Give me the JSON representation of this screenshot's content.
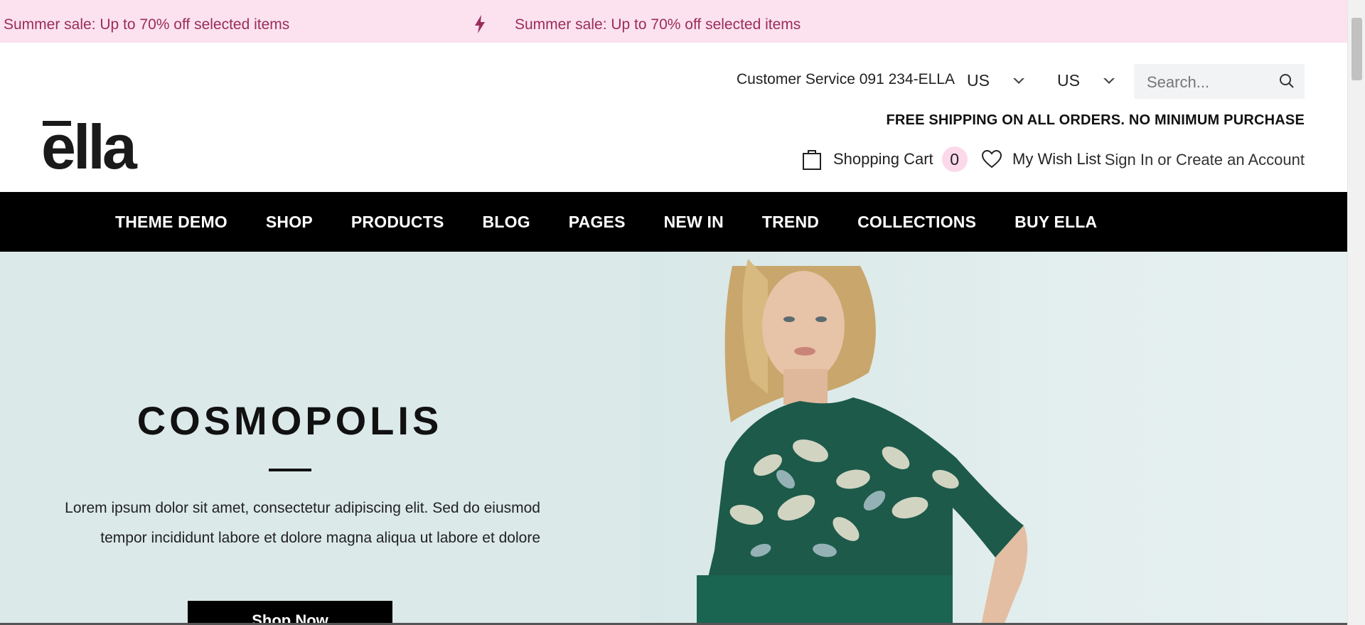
{
  "announcement": {
    "messages": [
      "Summer sale: Up to 70% off selected items",
      "Summer sale: Up to 70% off selected items"
    ],
    "icon": "lightning-bolt-icon",
    "color": "#9b2c5c",
    "background": "#fbe2ee"
  },
  "header": {
    "logo_text": "ella",
    "customer_service": "Customer Service 091 234-ELLA",
    "language": "US",
    "currency": "US",
    "search_placeholder": "Search...",
    "shipping_notice": "FREE SHIPPING ON ALL ORDERS. NO MINIMUM PURCHASE",
    "cart_label": "Shopping Cart",
    "cart_count": "0",
    "wishlist_label": "My Wish List",
    "account_label": "Sign In or Create an Account"
  },
  "nav": {
    "items": [
      "THEME DEMO",
      "SHOP",
      "PRODUCTS",
      "BLOG",
      "PAGES",
      "NEW IN",
      "TREND",
      "COLLECTIONS",
      "BUY ELLA"
    ]
  },
  "hero": {
    "title": "COSMOPOLIS",
    "description": "Lorem ipsum dolor sit amet, consectetur adipiscing elit. Sed do eiusmod tempor incididunt labore et dolore magna aliqua ut labore et dolore",
    "cta": "Shop Now"
  },
  "colors": {
    "nav_bg": "#000000",
    "hero_bg": "#dbe9e9",
    "badge_bg": "#fbd9ea"
  }
}
